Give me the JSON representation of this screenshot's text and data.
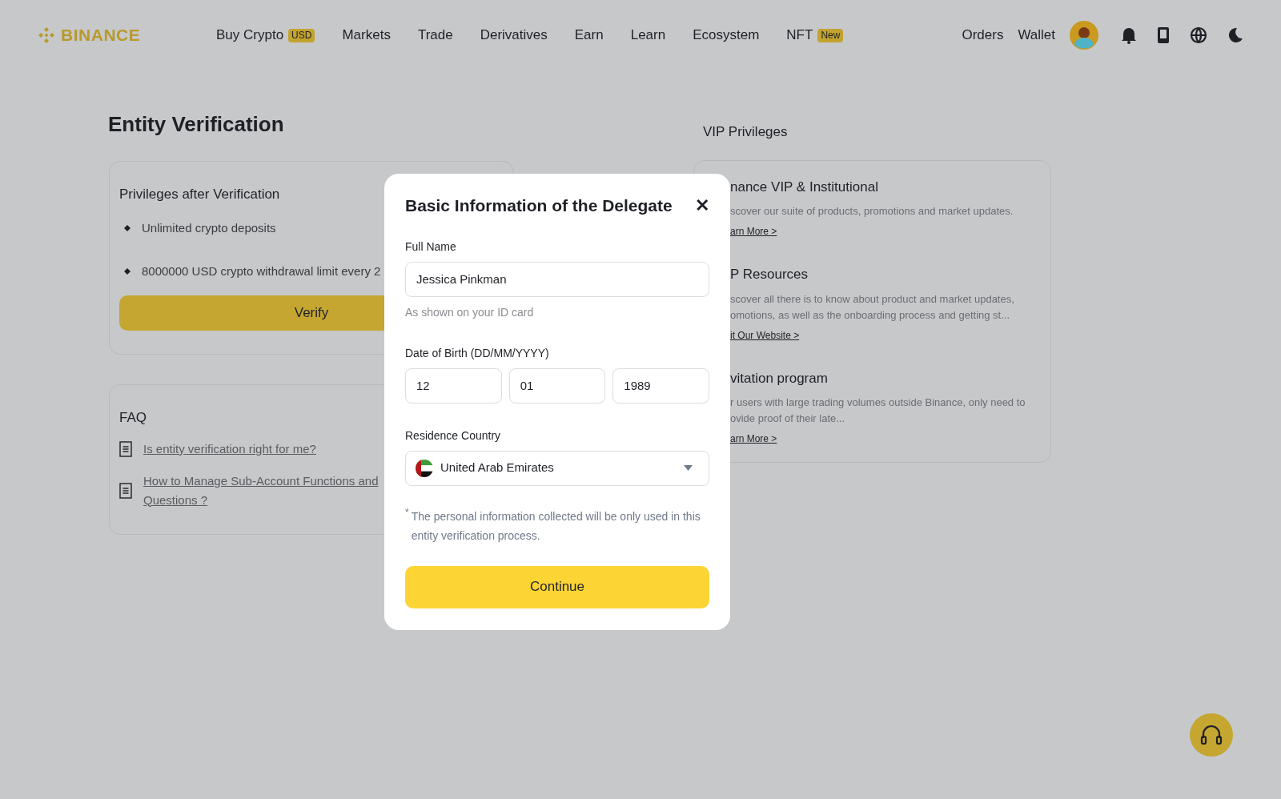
{
  "nav": {
    "logo": "BINANCE",
    "items": [
      {
        "label": "Buy Crypto",
        "badge": "USD"
      },
      {
        "label": "Markets"
      },
      {
        "label": "Trade"
      },
      {
        "label": "Derivatives"
      },
      {
        "label": "Earn"
      },
      {
        "label": "Learn"
      },
      {
        "label": "Ecosystem"
      },
      {
        "label": "NFT",
        "badge": "New"
      }
    ],
    "links": [
      "Orders",
      "Wallet"
    ]
  },
  "title": "Entity Verification",
  "privileges": {
    "title": "Privileges after Verification",
    "bullets": [
      "Unlimited crypto deposits",
      "8000000 USD crypto withdrawal limit every 2"
    ],
    "button": "Verify"
  },
  "faq": {
    "title": "FAQ",
    "links": [
      "Is entity verification right for me?",
      "How to Manage Sub-Account Functions and Questions ?"
    ]
  },
  "vip": {
    "heading": "VIP Privileges",
    "items": [
      {
        "title": "nance VIP & Institutional",
        "desc": "scover our suite of products, promotions and market updates.",
        "link": "arn More >"
      },
      {
        "title": "P Resources",
        "desc": "scover all there is to know about product and market updates, omotions, as well as the onboarding process and getting st...",
        "link": "it Our Website >"
      },
      {
        "title": "vitation program",
        "desc": "r users with large trading volumes outside Binance, only need to ovide proof of their late...",
        "link": "arn More >"
      }
    ]
  },
  "modal": {
    "title": "Basic Information of the Delegate",
    "close": "✕",
    "name_label": "Full Name",
    "name_value": "Jessica Pinkman",
    "name_hint": "As shown on your ID card",
    "dob_label": "Date of Birth (DD/MM/YYYY)",
    "dob": [
      "12",
      "01",
      "1989"
    ],
    "country_label": "Residence Country",
    "country": "United Arab Emirates",
    "note_mark": "*",
    "note": "The personal information collected will be only used in this entity verification process.",
    "button": "Continue"
  }
}
